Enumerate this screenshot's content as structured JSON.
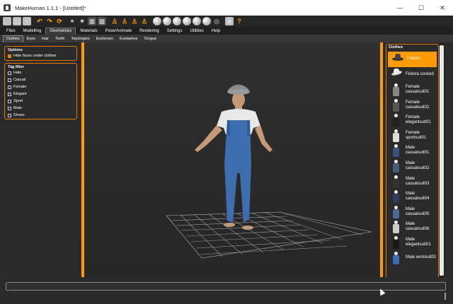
{
  "window": {
    "title": "MakeHuman 1.1.1 - [Untitled]*",
    "minimize": "—",
    "maximize": "☐",
    "close": "✕"
  },
  "toolbar": {
    "icons": [
      "new-file",
      "save",
      "load",
      "undo",
      "redo",
      "reset",
      "smooth",
      "wireframe",
      "grid",
      "checker",
      "front-view",
      "side-view",
      "back-view",
      "top-view",
      "sphere-1",
      "sphere-2",
      "sphere-3",
      "sphere-4",
      "sphere-5",
      "sphere-6",
      "screenshot",
      "help"
    ]
  },
  "main_tabs": [
    "Files",
    "Modelling",
    "Geometries",
    "Materials",
    "Pose/Animate",
    "Rendering",
    "Settings",
    "Utilities",
    "Help"
  ],
  "main_tabs_active": "Geometries",
  "sub_tabs": [
    "Clothes",
    "Eyes",
    "Hair",
    "Teeth",
    "Topologies",
    "Eyebrows",
    "Eyelashes",
    "Tongue"
  ],
  "sub_tabs_active": "Clothes",
  "options": {
    "title": "Options",
    "hide_faces_label": "Hide faces under clothes"
  },
  "tag_filter": {
    "title": "Tag filter",
    "tags": [
      "Hats",
      "Casual",
      "Female",
      "Elegant",
      "Sport",
      "Male",
      "Shoes"
    ]
  },
  "clothes": {
    "title": "Clothes",
    "items": [
      {
        "label": "Fedora",
        "selected": true
      },
      {
        "label": "Fedora cocked"
      },
      {
        "label": "Female casualsuit01"
      },
      {
        "label": "Female casualsuit02"
      },
      {
        "label": "Female elegantsuit01"
      },
      {
        "label": "Female sportsuit01"
      },
      {
        "label": "Male casualsuit01"
      },
      {
        "label": "Male casualsuit02"
      },
      {
        "label": "Male casualsuit03"
      },
      {
        "label": "Male casualsuit04"
      },
      {
        "label": "Male casualsuit05"
      },
      {
        "label": "Male casualsuit06"
      },
      {
        "label": "Male elegantsuit01"
      },
      {
        "label": "Male worksuit01"
      }
    ]
  },
  "colors": {
    "accent": "#ff9a00",
    "panel": "#2a2a2a",
    "viewport": "#2b2b2b"
  }
}
